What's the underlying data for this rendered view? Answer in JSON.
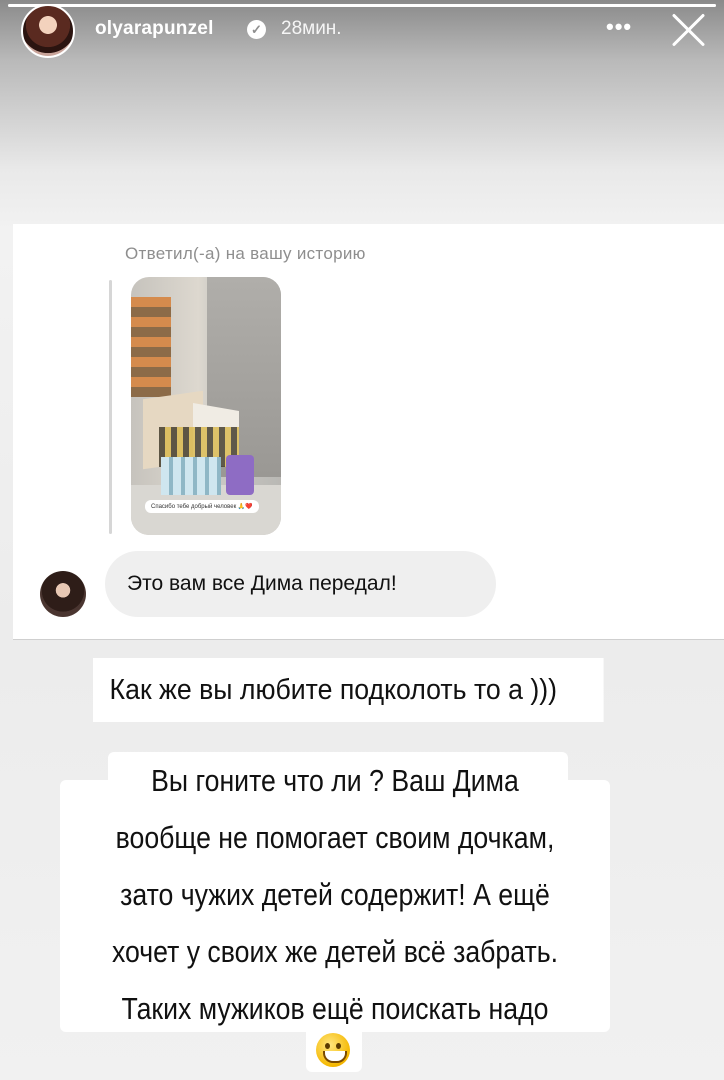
{
  "header": {
    "username": "olyarapunzel",
    "time": "28мин.",
    "more": "•••"
  },
  "story_progress": 1.0,
  "dm": {
    "reply_caption": "Ответил(-а) на вашу историю",
    "thumb_caption": "Спасибо тебе добрый человек 🙏❤️",
    "message": "Это вам все Дима передал!"
  },
  "story_text": {
    "line1": "Как же вы любите подколоть то а )))",
    "lines": [
      "Вы гоните что ли ? Ваш Дима",
      "вообще не помогает своим дочкам,",
      "зато чужих детей содержит!  А ещё",
      "хочет у своих же детей всё забрать.",
      "Таких мужиков ещё поискать надо"
    ],
    "emoji": "grinning-face-icon"
  }
}
